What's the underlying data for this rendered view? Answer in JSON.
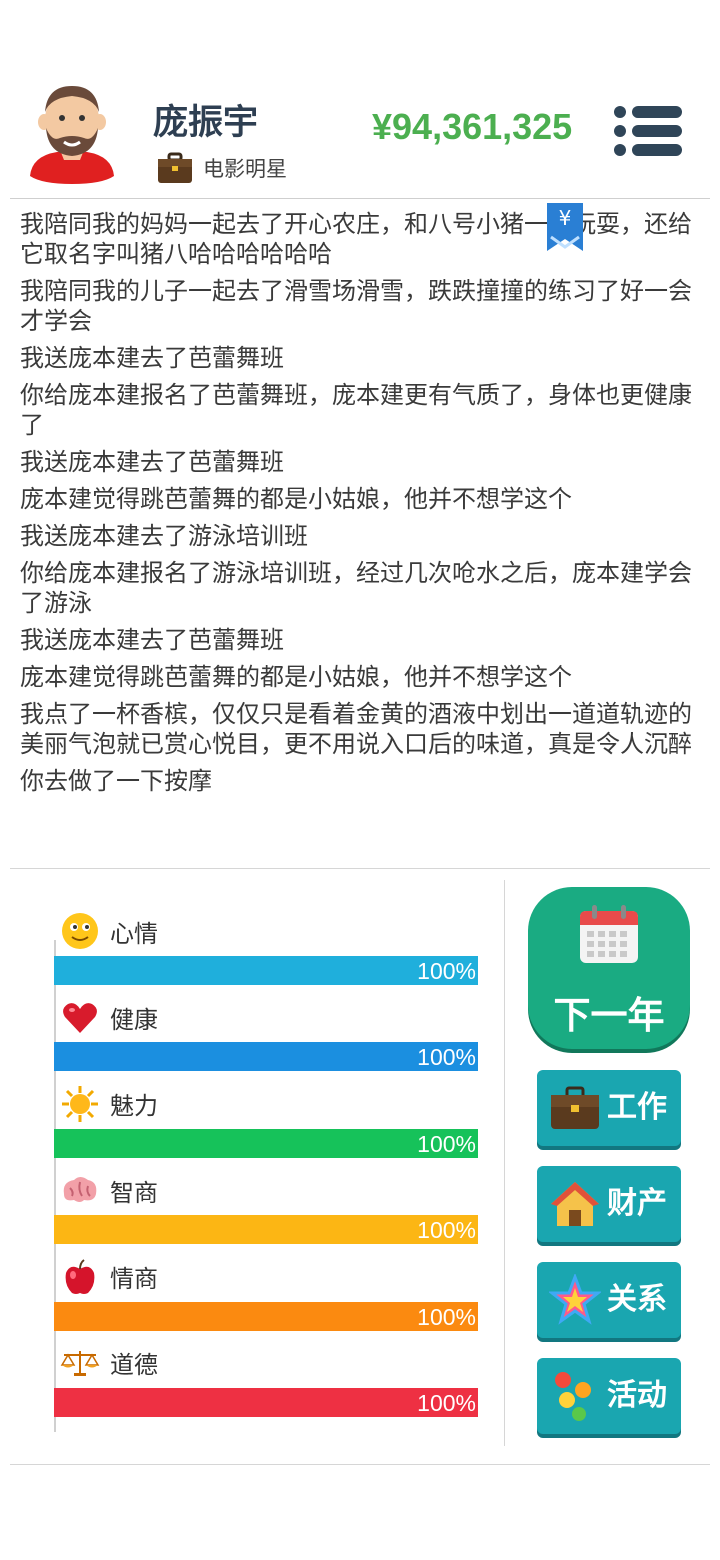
{
  "player": {
    "name": "庞振宇",
    "job": "电影明星",
    "money": "¥94,361,325"
  },
  "log": [
    "我陪同我的妈妈一起去了开心农庄，和八号小猪一起玩耍，还给它取名字叫猪八哈哈哈哈哈哈",
    "我陪同我的儿子一起去了滑雪场滑雪，跌跌撞撞的练习了好一会才学会",
    "我送庞本建去了芭蕾舞班",
    "你给庞本建报名了芭蕾舞班，庞本建更有气质了，身体也更健康了",
    "我送庞本建去了芭蕾舞班",
    "庞本建觉得跳芭蕾舞的都是小姑娘，他并不想学这个",
    "我送庞本建去了游泳培训班",
    "你给庞本建报名了游泳培训班，经过几次呛水之后，庞本建学会了游泳",
    "我送庞本建去了芭蕾舞班",
    "庞本建觉得跳芭蕾舞的都是小姑娘，他并不想学这个",
    "我点了一杯香槟，仅仅只是看着金黄的酒液中划出一道道轨迹的美丽气泡就已赏心悦目，更不用说入口后的味道，真是令人沉醉",
    "你去做了一下按摩"
  ],
  "bookmark_glyph": "¥",
  "stats": [
    {
      "label": "心情",
      "value": 100,
      "text": "100%",
      "color": "#1fafdc",
      "icon": "smiley-icon"
    },
    {
      "label": "健康",
      "value": 100,
      "text": "100%",
      "color": "#1b8fe0",
      "icon": "heart-icon"
    },
    {
      "label": "魅力",
      "value": 100,
      "text": "100%",
      "color": "#16c25a",
      "icon": "sun-icon"
    },
    {
      "label": "智商",
      "value": 100,
      "text": "100%",
      "color": "#fcb614",
      "icon": "brain-icon"
    },
    {
      "label": "情商",
      "value": 100,
      "text": "100%",
      "color": "#fb8a10",
      "icon": "apple-icon"
    },
    {
      "label": "道德",
      "value": 100,
      "text": "100%",
      "color": "#ee3043",
      "icon": "scales-icon"
    }
  ],
  "actions": {
    "next_year": "下一年",
    "work": "工作",
    "property": "财产",
    "relations": "关系",
    "activities": "活动"
  }
}
